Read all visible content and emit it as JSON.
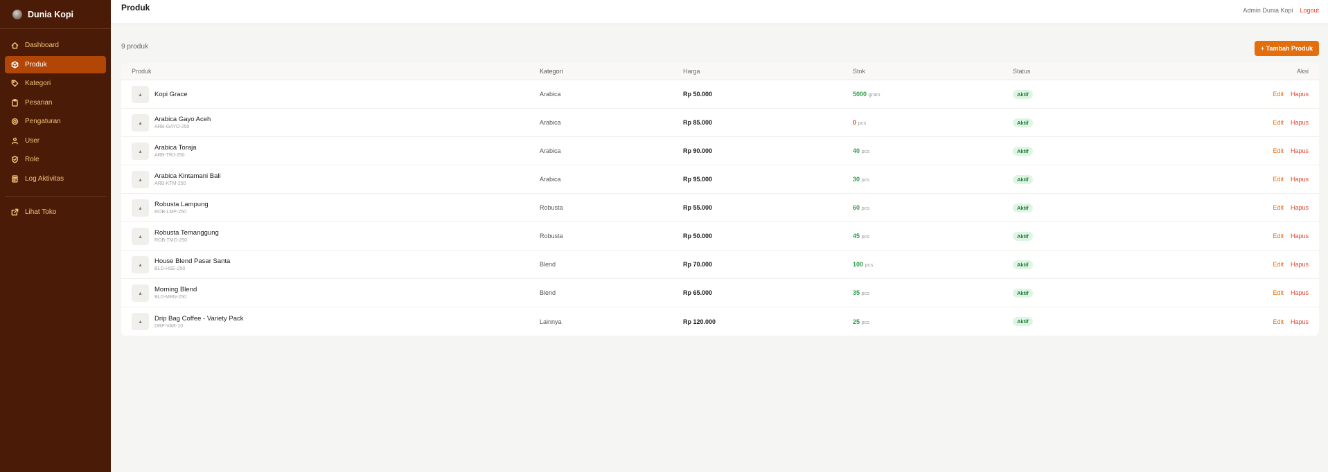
{
  "brand": {
    "name": "Dunia Kopi"
  },
  "sidebar": {
    "items": [
      {
        "label": "Dashboard",
        "icon": "home-icon",
        "active": false
      },
      {
        "label": "Produk",
        "icon": "box-icon",
        "active": true
      },
      {
        "label": "Kategori",
        "icon": "tag-icon",
        "active": false
      },
      {
        "label": "Pesanan",
        "icon": "clipboard-icon",
        "active": false
      },
      {
        "label": "Pengaturan",
        "icon": "gear-icon",
        "active": false
      },
      {
        "label": "User",
        "icon": "user-icon",
        "active": false
      },
      {
        "label": "Role",
        "icon": "shield-icon",
        "active": false
      },
      {
        "label": "Log Aktivitas",
        "icon": "document-icon",
        "active": false
      }
    ],
    "external": {
      "label": "Lihat Toko",
      "icon": "external-link-icon"
    }
  },
  "header": {
    "title": "Produk",
    "admin_name": "Admin Dunia Kopi",
    "logout_label": "Logout"
  },
  "toolbar": {
    "count": "9 produk",
    "add_label": "+ Tambah Produk"
  },
  "table": {
    "headers": {
      "produk": "Produk",
      "kategori": "Kategori",
      "harga": "Harga",
      "stok": "Stok",
      "status": "Status",
      "aksi": "Aksi"
    },
    "edit_label": "Edit",
    "delete_label": "Hapus",
    "rows": [
      {
        "name": "Kopi Grace",
        "sku": "",
        "kategori": "Arabica",
        "harga": "Rp 50.000",
        "stok": "5000",
        "unit": "gram",
        "status": "Aktif"
      },
      {
        "name": "Arabica Gayo Aceh",
        "sku": "ARB-GAYO-250",
        "kategori": "Arabica",
        "harga": "Rp 85.000",
        "stok": "0",
        "unit": "pcs",
        "status": "Aktif"
      },
      {
        "name": "Arabica Toraja",
        "sku": "ARB-TRJ-250",
        "kategori": "Arabica",
        "harga": "Rp 90.000",
        "stok": "40",
        "unit": "pcs",
        "status": "Aktif"
      },
      {
        "name": "Arabica Kintamani Bali",
        "sku": "ARB-KTM-250",
        "kategori": "Arabica",
        "harga": "Rp 95.000",
        "stok": "30",
        "unit": "pcs",
        "status": "Aktif"
      },
      {
        "name": "Robusta Lampung",
        "sku": "ROB-LMP-250",
        "kategori": "Robusta",
        "harga": "Rp 55.000",
        "stok": "60",
        "unit": "pcs",
        "status": "Aktif"
      },
      {
        "name": "Robusta Temanggung",
        "sku": "ROB-TMG-250",
        "kategori": "Robusta",
        "harga": "Rp 50.000",
        "stok": "45",
        "unit": "pcs",
        "status": "Aktif"
      },
      {
        "name": "House Blend Pasar Santa",
        "sku": "BLD-HSE-250",
        "kategori": "Blend",
        "harga": "Rp 70.000",
        "stok": "100",
        "unit": "pcs",
        "status": "Aktif"
      },
      {
        "name": "Morning Blend",
        "sku": "BLD-MRN-250",
        "kategori": "Blend",
        "harga": "Rp 65.000",
        "stok": "35",
        "unit": "pcs",
        "status": "Aktif"
      },
      {
        "name": "Drip Bag Coffee - Variety Pack",
        "sku": "DRP-VAR-10",
        "kategori": "Lainnya",
        "harga": "Rp 120.000",
        "stok": "25",
        "unit": "pcs",
        "status": "Aktif"
      }
    ]
  },
  "colors": {
    "sidebar_bg": "#4a1c07",
    "active_bg": "#b24607",
    "accent": "#e46e0c",
    "danger": "#e0452c",
    "success": "#2e9b4a"
  }
}
